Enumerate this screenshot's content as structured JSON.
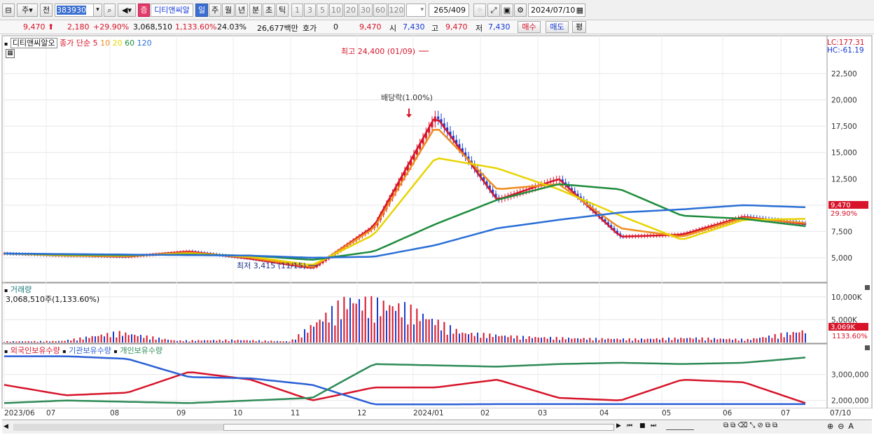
{
  "toolbar": {
    "market_mode": "주",
    "prev_label": "전",
    "code": "383930",
    "stock_badge": "증",
    "stock_name": "디티앤씨알",
    "periods": [
      "일",
      "주",
      "월",
      "년",
      "분",
      "초",
      "틱"
    ],
    "active_period": "일",
    "intervals": [
      "1",
      "3",
      "5",
      "10",
      "20",
      "30",
      "60",
      "120"
    ],
    "count": "265",
    "count_total": "/409",
    "date": "2024/07/10"
  },
  "quote": {
    "price": "9,470",
    "change": "2,180",
    "change_pct": "+29.90%",
    "volume": "3,068,510",
    "volume_pct": "1,133.60%",
    "turnover": "24.03%",
    "amount": "26,677백만",
    "bid_label": "호가",
    "bid_value": "0",
    "bid_price": "9,470",
    "open_label": "시",
    "open_value": "7,430",
    "high_label": "고",
    "high_value": "9,470",
    "low_label": "저",
    "low_value": "7,430",
    "buy_label": "매수",
    "sell_label": "매도",
    "eval_label": "평"
  },
  "price_panel": {
    "stock_label": "디티앤씨알오",
    "indicator_label": "종가 단순",
    "ma_labels": [
      {
        "label": "5",
        "color": "#d7142a"
      },
      {
        "label": "10",
        "color": "#f08c1e"
      },
      {
        "label": "20",
        "color": "#e8d400"
      },
      {
        "label": "60",
        "color": "#1e8c3c"
      },
      {
        "label": "120",
        "color": "#2a6fd6"
      }
    ],
    "lc": "LC:177.31",
    "hc": "HC:-61.19",
    "high_annotation": "최고 24,400 (01/09)",
    "low_annotation": "최저 3,415 (11/15)",
    "dividend_annotation": "배당락(1.00%)",
    "last_price_tag": "9,470",
    "last_pct_tag": "29.90%"
  },
  "volume_panel": {
    "title": "거래량",
    "value_text": "3,068,510주(1,133.60%)",
    "last_tag": "3,069K",
    "last_pct_tag": "1133.60%"
  },
  "holding_panel": {
    "series": [
      {
        "name": "외국인보유수량",
        "color": "#d7142a"
      },
      {
        "name": "기관보유수량",
        "color": "#2a5fd6"
      },
      {
        "name": "개인보유수량",
        "color": "#2e8b57"
      }
    ]
  },
  "x_axis_labels": [
    "2023/06",
    "07",
    "08",
    "09",
    "10",
    "11",
    "12",
    "2024/01",
    "02",
    "03",
    "04",
    "05",
    "06",
    "07",
    "07/10"
  ],
  "chart_data": [
    {
      "type": "line",
      "title": "",
      "ylabel": "",
      "y_ticks": [
        5000,
        7500,
        10000,
        12500,
        15000,
        17500,
        20000,
        22500
      ],
      "y_tick_labels": [
        "5,000",
        "7,500",
        "10,000",
        "12,500",
        "15,000",
        "17,500",
        "20,000",
        "22,500"
      ],
      "ylim": [
        3000,
        25500
      ],
      "x": [
        "2023/06",
        "07",
        "08",
        "09",
        "10",
        "11",
        "12",
        "2024/01",
        "02",
        "03",
        "04",
        "05",
        "06",
        "07",
        "07/10"
      ],
      "series": [
        {
          "name": "5",
          "values": [
            5400,
            5200,
            5100,
            5600,
            4900,
            4000,
            8000,
            18500,
            10500,
            12500,
            7000,
            7200,
            8900,
            8200,
            8900
          ]
        },
        {
          "name": "10",
          "values": [
            5400,
            5200,
            5150,
            5500,
            5000,
            4100,
            7800,
            17500,
            11500,
            12000,
            7800,
            7000,
            8800,
            8300,
            8500
          ]
        },
        {
          "name": "20",
          "values": [
            5400,
            5250,
            5200,
            5400,
            5100,
            4300,
            7200,
            14500,
            13500,
            11500,
            9000,
            6700,
            8600,
            8700,
            8400
          ]
        },
        {
          "name": "60",
          "values": [
            5400,
            5300,
            5250,
            5300,
            5200,
            4800,
            5600,
            8200,
            10500,
            12000,
            11500,
            9000,
            8700,
            8000,
            8000
          ]
        },
        {
          "name": "120",
          "values": [
            5400,
            5350,
            5300,
            5250,
            5200,
            5000,
            5100,
            6200,
            7800,
            8600,
            9300,
            9600,
            10000,
            9800,
            9300
          ]
        }
      ]
    },
    {
      "type": "bar",
      "title": "거래량",
      "y_ticks": [
        5000,
        10000
      ],
      "y_tick_labels": [
        "5,000K",
        "10,000K"
      ],
      "ylim": [
        0,
        11500
      ],
      "x": [
        "2023/06",
        "07",
        "08",
        "09",
        "10",
        "11",
        "12",
        "2024/01",
        "02",
        "03",
        "04",
        "05",
        "06",
        "07",
        "07/10"
      ],
      "values": [
        300,
        400,
        2600,
        500,
        700,
        300,
        11000,
        9000,
        2500,
        1500,
        1100,
        900,
        1200,
        800,
        3069
      ]
    },
    {
      "type": "line",
      "y_ticks": [
        2000000,
        3000000
      ],
      "y_tick_labels": [
        "2,000,000",
        "3,000,000"
      ],
      "ylim": [
        1750000,
        3850000
      ],
      "x": [
        "2023/06",
        "07",
        "08",
        "09",
        "10",
        "11",
        "12",
        "2024/01",
        "02",
        "03",
        "04",
        "05",
        "06",
        "07",
        "07/10"
      ],
      "series": [
        {
          "name": "외국인보유수량",
          "values": [
            2600,
            2200,
            2300,
            3100,
            2800,
            2000,
            2500,
            2500,
            2800,
            2100,
            2000,
            2800,
            2700,
            1900,
            1950
          ]
        },
        {
          "name": "기관보유수량",
          "values": [
            3700,
            3700,
            3600,
            2900,
            2850,
            2600,
            1850,
            1850,
            1860,
            1860,
            1860,
            1860,
            1860,
            1860,
            1860
          ]
        },
        {
          "name": "개인보유수량",
          "values": [
            1900,
            2000,
            1950,
            1900,
            2000,
            2100,
            3400,
            3350,
            3300,
            3400,
            3450,
            3400,
            3450,
            3650,
            3700
          ]
        }
      ]
    }
  ]
}
